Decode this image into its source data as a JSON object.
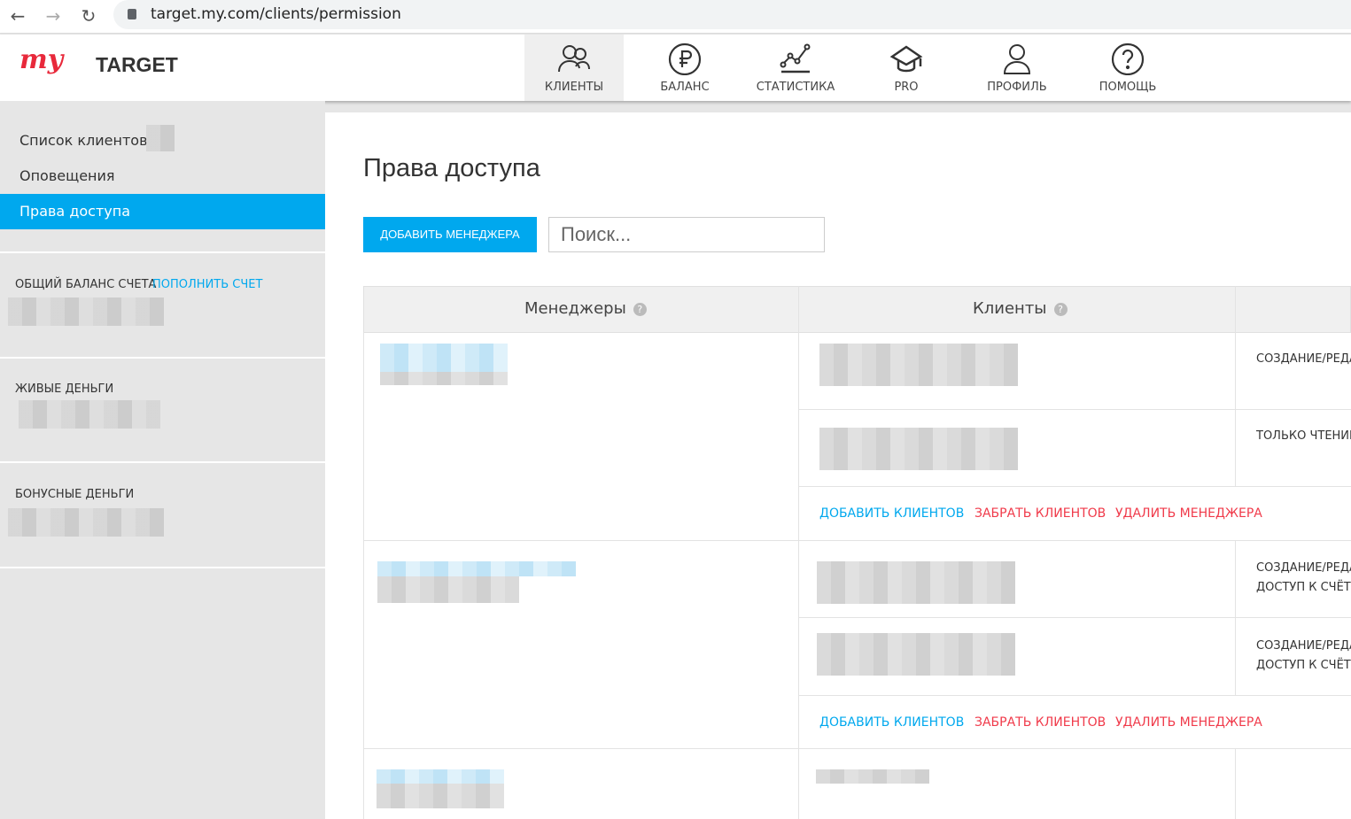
{
  "browser": {
    "url": "target.my.com/clients/permission"
  },
  "logo": {
    "my": "my",
    "target": "TARGET"
  },
  "nav": [
    {
      "label": "КЛИЕНТЫ",
      "icon": "clients-icon"
    },
    {
      "label": "БАЛАНС",
      "icon": "ruble-icon"
    },
    {
      "label": "СТАТИСТИКА",
      "icon": "chart-icon"
    },
    {
      "label": "PRO",
      "icon": "graduation-cap-icon"
    },
    {
      "label": "ПРОФИЛЬ",
      "icon": "profile-icon"
    },
    {
      "label": "ПОМОЩЬ",
      "icon": "help-icon"
    }
  ],
  "sidebar": {
    "items": [
      "Список клиентов",
      "Оповещения",
      "Права доступа"
    ],
    "balance_label": "ОБЩИЙ БАЛАНС СЧЕТА",
    "topup": "ПОПОЛНИТЬ СЧЕТ",
    "live_money": "ЖИВЫЕ ДЕНЬГИ",
    "bonus_money": "БОНУСНЫЕ ДЕНЬГИ"
  },
  "main": {
    "title": "Права доступа",
    "add_manager": "ДОБАВИТЬ МЕНЕДЖЕРА",
    "search_placeholder": "Поиск...",
    "columns": [
      "Менеджеры",
      "Клиенты"
    ],
    "perms": [
      "СОЗДАНИЕ/РЕДАКТИРОВАНИЕ",
      "ТОЛЬКО ЧТЕНИЕ",
      "СОЗДАНИЕ/РЕДАКТИРОВАНИЕ",
      "ДОСТУП К СЧЁТУ",
      "СОЗДАНИЕ/РЕДАКТИРОВАНИЕ",
      "ДОСТУП К СЧЁТУ"
    ],
    "actions": {
      "add": "ДОБАВИТЬ КЛИЕНТОВ",
      "take": "ЗАБРАТЬ КЛИЕНТОВ",
      "delete": "УДАЛИТЬ МЕНЕДЖЕРА"
    }
  }
}
